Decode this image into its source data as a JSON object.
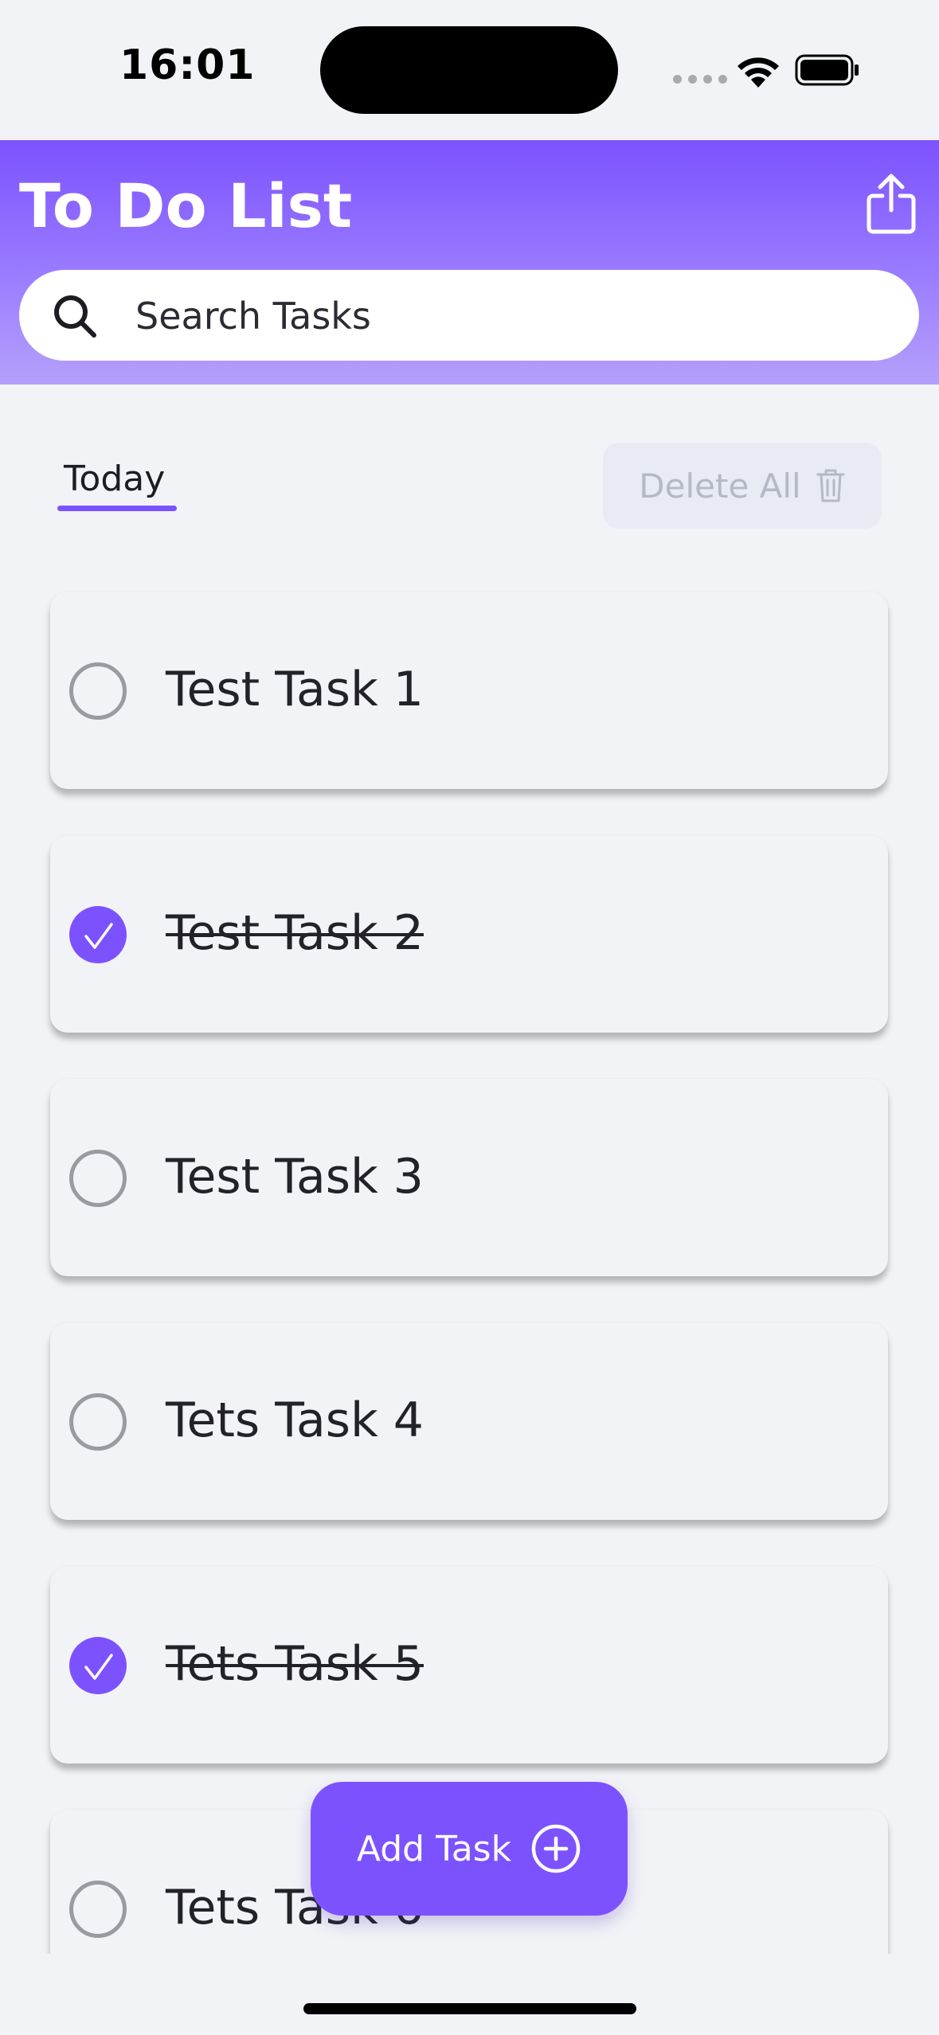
{
  "status_bar": {
    "time": "16:01"
  },
  "header": {
    "title": "To Do List",
    "search_placeholder": "Search Tasks"
  },
  "filter": {
    "active_tab": "Today",
    "delete_all_label": "Delete All"
  },
  "tasks": [
    {
      "label": "Test Task 1",
      "completed": false
    },
    {
      "label": "Test Task 2",
      "completed": true
    },
    {
      "label": "Test Task 3",
      "completed": false
    },
    {
      "label": "Tets Task 4",
      "completed": false
    },
    {
      "label": "Tets Task 5",
      "completed": true
    },
    {
      "label": "Tets Task 6",
      "completed": false
    }
  ],
  "fab": {
    "label": "Add Task"
  },
  "colors": {
    "accent": "#7c52ff",
    "background": "#f2f3f7",
    "delete_disabled_bg": "#e8ebf3",
    "delete_disabled_text": "#b5b9c5"
  }
}
